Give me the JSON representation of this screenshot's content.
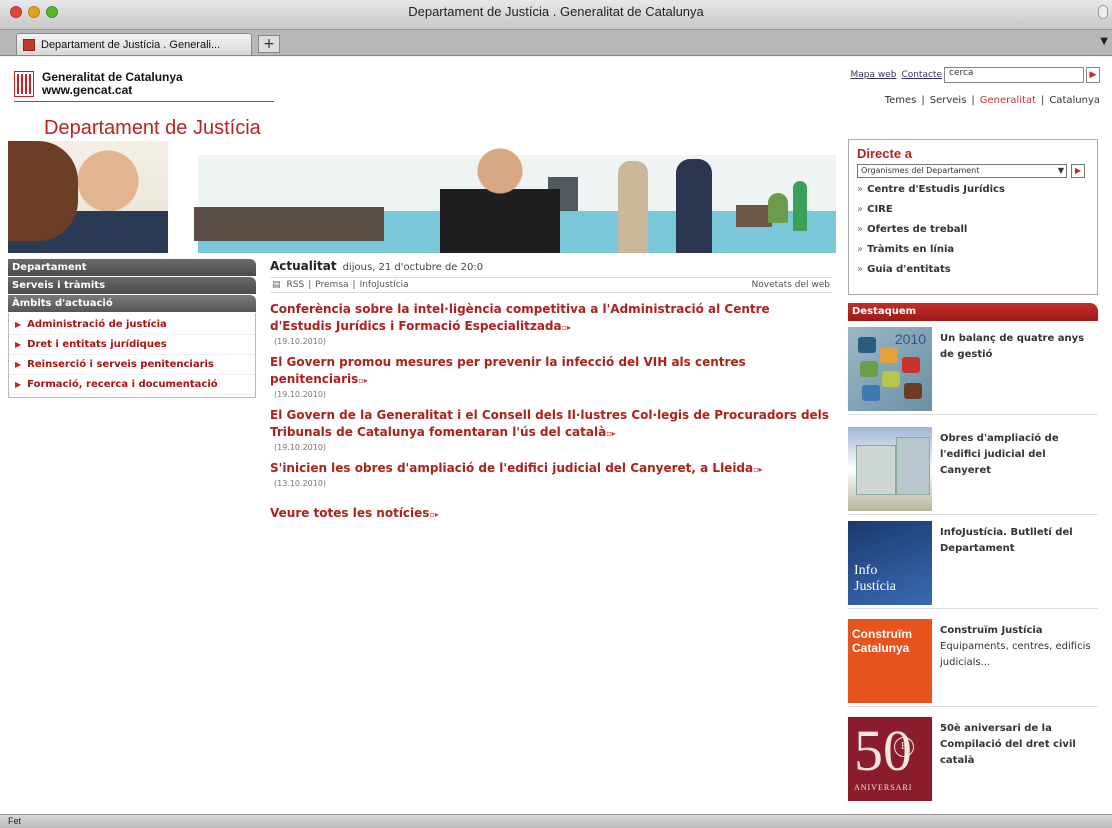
{
  "window": {
    "title": "Departament de Justícia . Generalitat de Catalunya",
    "tab_label": "Departament de Justícia . Generali...",
    "tab_add": "+",
    "status": "Fet"
  },
  "header": {
    "logo_line1": "Generalitat de Catalunya",
    "logo_line2": "www.gencat.cat",
    "link_mapa": "Mapa web",
    "link_contacte": "Contacte",
    "search_value": "cerca",
    "nav": [
      "Temes",
      "Serveis",
      "Generalitat",
      "Catalunya"
    ],
    "dept_title": "Departament de Justícia"
  },
  "sidebar": {
    "headings": [
      "Departament",
      "Serveis i tràmits",
      "Àmbits d'actuació"
    ],
    "items": [
      "Administració de justícia",
      "Dret i entitats jurídiques",
      "Reinserció i serveis penitenciaris",
      "Formació, recerca i documentació"
    ]
  },
  "news": {
    "title": "Actualitat",
    "date": "dijous, 21 d'octubre de 20:0",
    "rss": "RSS",
    "premsa": "Premsa",
    "infojusticia": "InfoJustícia",
    "novetats": "Novetats del web",
    "items": [
      {
        "title": "Conferència sobre la intel·ligència competitiva a l'Administració al Centre d'Estudis Jurídics i Formació Especialitzada",
        "date": "(19.10.2010)"
      },
      {
        "title": "El Govern promou mesures per prevenir la infecció del VIH als centres penitenciaris",
        "date": "(19.10.2010)"
      },
      {
        "title": "El Govern de la Generalitat i el Consell dels Il·lustres Col·legis de Procuradors dels Tribunals de Catalunya fomentaran l'ús del català",
        "date": "(19.10.2010)"
      },
      {
        "title": "S'inicien les obres d'ampliació de l'edifici judicial del Canyeret, a Lleida",
        "date": "(13.10.2010)"
      }
    ],
    "see_all": "Veure totes les notícies"
  },
  "directe": {
    "title": "Directe a",
    "select_value": "Organismes del Departament",
    "items": [
      "Centre d'Estudis Jurídics",
      "CIRE",
      "Ofertes de treball",
      "Tràmits en línia",
      "Guia d'entitats"
    ]
  },
  "destaquem": {
    "title": "Destaquem",
    "features": [
      {
        "text": "Un balanç de quatre anys de gestió",
        "badge": "2010"
      },
      {
        "text": "Obres d'ampliació de l'edifici judicial del Canyeret"
      },
      {
        "text": "InfoJustícia. Butlletí del Departament",
        "badge_line1": "Info",
        "badge_line2": "Justícia"
      },
      {
        "text": "Construïm Justícia",
        "subtext": "Equipaments, centres, edificis judicials...",
        "badge_line1": "Construïm",
        "badge_line2": "Catalunya"
      },
      {
        "text": "50è aniversari de la Compilació del dret civil català",
        "badge_number": "50",
        "badge_circle": "E",
        "badge_word": "ANIVERSARI"
      }
    ]
  }
}
